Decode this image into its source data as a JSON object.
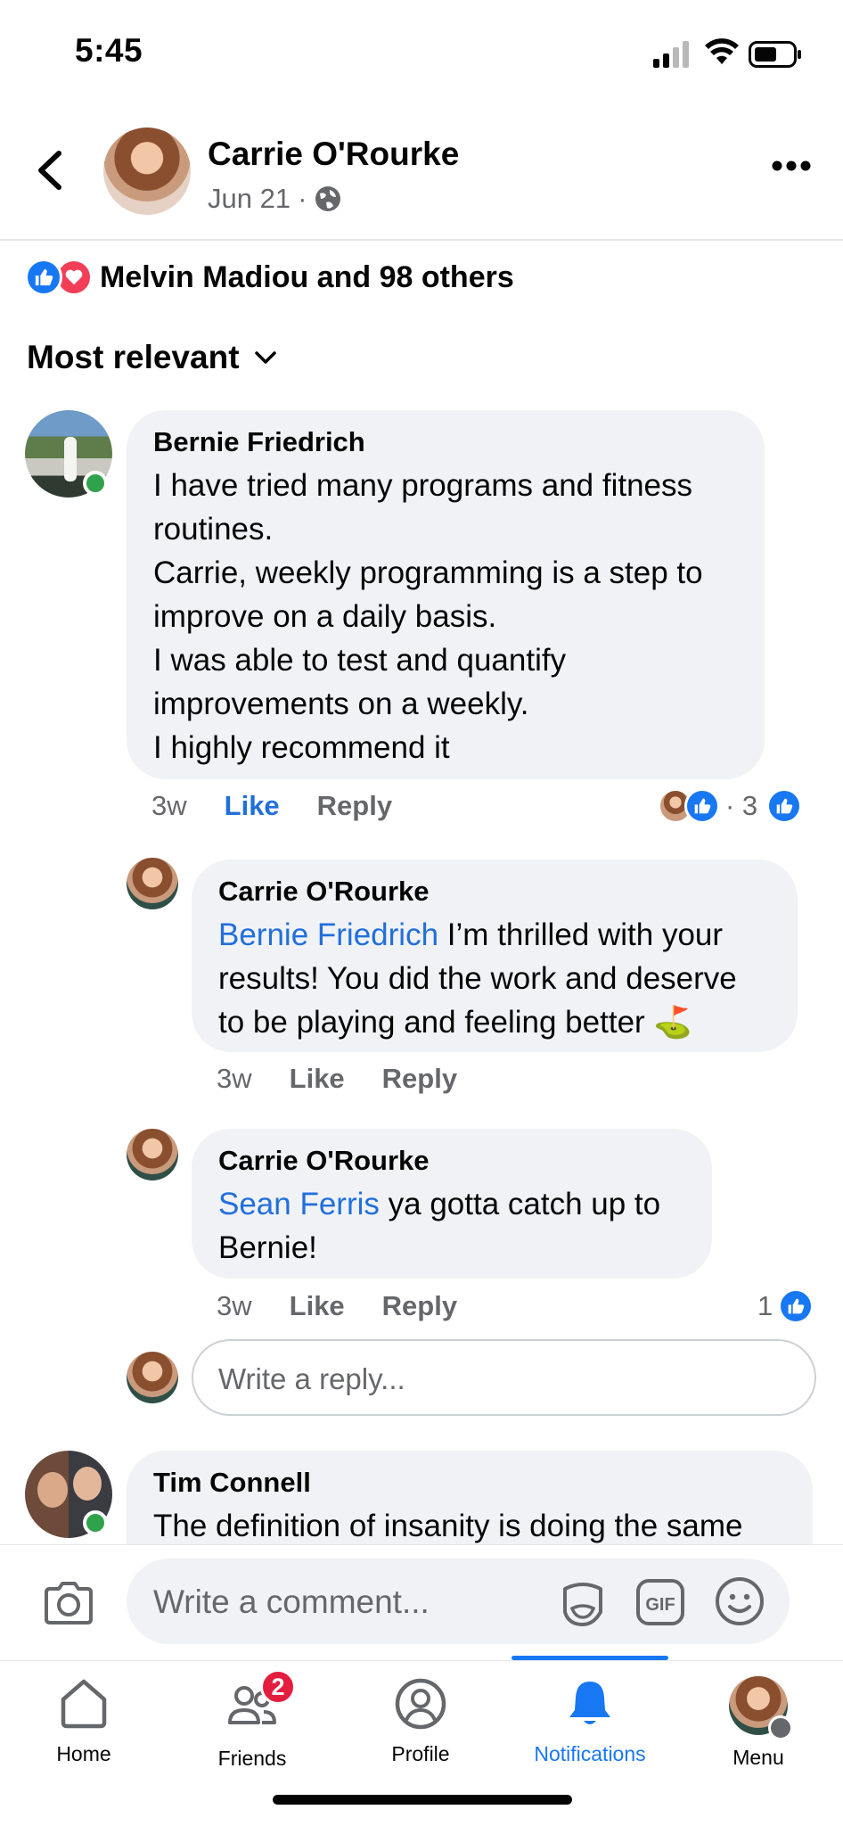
{
  "status_bar": {
    "time": "5:45"
  },
  "post_header": {
    "name": "Carrie O'Rourke",
    "date": "Jun 21",
    "separator": "·"
  },
  "reactions": {
    "summary": "Melvin Madiou and 98 others"
  },
  "sort": {
    "label": "Most relevant"
  },
  "comments": [
    {
      "author": "Bernie Friedrich",
      "text": "I have tried many programs and fitness routines.\nCarrie, weekly programming is a step to improve on a daily basis.\nI was able to test and quantify improvements on a weekly.\nI highly recommend it",
      "time": "3w",
      "like": "Like",
      "reply": "Reply",
      "reaction_count": "· 3",
      "replies": [
        {
          "author": "Carrie O'Rourke",
          "tag": "Bernie Friedrich",
          "text": " I’m thrilled with your results! You did the work and deserve to be playing and feeling better ⛳",
          "time": "3w",
          "like": "Like",
          "reply": "Reply"
        },
        {
          "author": "Carrie O'Rourke",
          "tag": "Sean Ferris",
          "text": " ya gotta catch up to Bernie!",
          "time": "3w",
          "like": "Like",
          "reply": "Reply",
          "reaction_count": "1"
        }
      ],
      "reply_placeholder": "Write a reply..."
    },
    {
      "author": "Tim Connell",
      "text": "The definition of insanity is doing the same"
    }
  ],
  "composer": {
    "placeholder": "Write a comment..."
  },
  "tabs": [
    {
      "label": "Home",
      "icon": "home-icon"
    },
    {
      "label": "Friends",
      "icon": "friends-icon",
      "badge": "2"
    },
    {
      "label": "Profile",
      "icon": "profile-icon"
    },
    {
      "label": "Notifications",
      "icon": "bell-icon",
      "active": true
    },
    {
      "label": "Menu",
      "icon": "menu-avatar"
    }
  ],
  "colors": {
    "accent": "#1877f2",
    "link": "#216fdb",
    "bubble": "#f0f2f5",
    "badge": "#e41e3f",
    "online": "#31a24c"
  }
}
